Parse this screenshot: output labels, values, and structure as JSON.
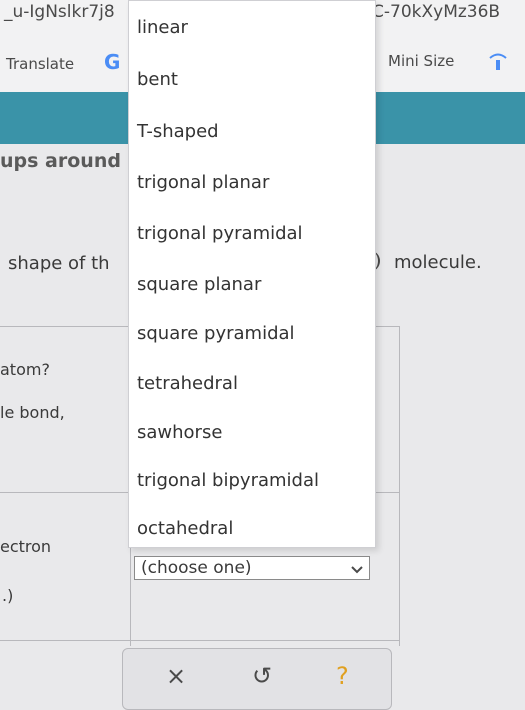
{
  "browser": {
    "url_left": "_u-IgNslkr7j8",
    "url_right": "C-70kXyMz36B",
    "translate_label": "Translate",
    "g_logo_letter": "G",
    "mini_size_label": "Mini Size"
  },
  "page": {
    "section_text": "ups around",
    "question_left": "shape of th",
    "question_right": "molecule.",
    "rows": {
      "atom": "atom?",
      "bond": "le bond,",
      "electron": "ectron",
      "paren": ".)"
    }
  },
  "dropdown": {
    "options": [
      "linear",
      "bent",
      "T-shaped",
      "trigonal planar",
      "trigonal pyramidal",
      "square planar",
      "square pyramidal",
      "tetrahedral",
      "sawhorse",
      "trigonal bipyramidal",
      "octahedral"
    ],
    "selected": "(choose one)"
  },
  "toolbar": {
    "close_glyph": "×",
    "undo_glyph": "↺",
    "help_glyph": "?"
  },
  "colors": {
    "teal_band": "#3a93a8",
    "g_logo": "#4b8df5",
    "help": "#e0a020"
  }
}
